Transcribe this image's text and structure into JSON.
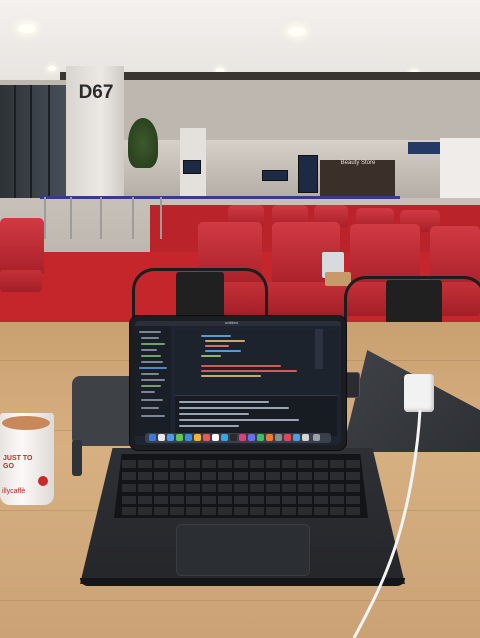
{
  "scene": {
    "gate_sign": "D67",
    "shop_sign": "Beauty Store",
    "cup_slogan": "JUST TO GO",
    "cup_brand": "illycaffè",
    "editor_title": "untitled"
  },
  "colors": {
    "carpet": "#c4262c",
    "seats": "#b8252e",
    "table_wood": "#d2aa7c",
    "laptop": "#1b1d20",
    "editor_bg": "#1e2430"
  }
}
